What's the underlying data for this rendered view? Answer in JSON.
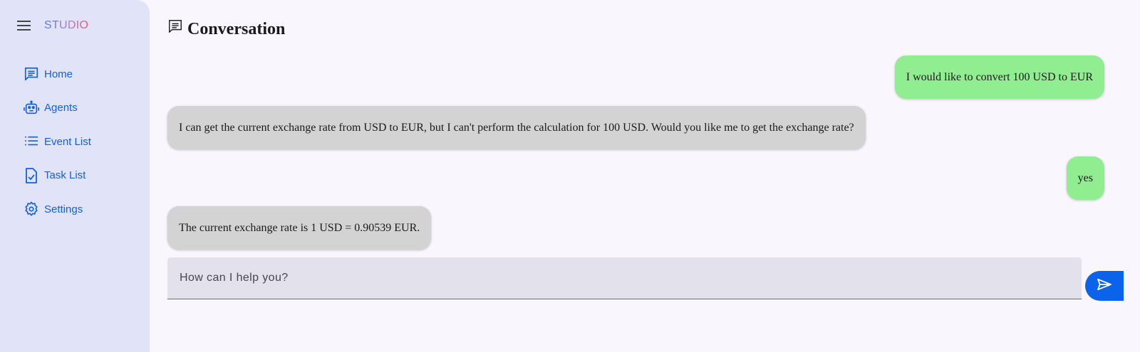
{
  "sidebar": {
    "brand": "STUDIO",
    "items": [
      {
        "label": "Home",
        "icon": "chat-icon"
      },
      {
        "label": "Agents",
        "icon": "robot-icon"
      },
      {
        "label": "Event List",
        "icon": "list-icon"
      },
      {
        "label": "Task List",
        "icon": "task-icon"
      },
      {
        "label": "Settings",
        "icon": "gear-icon"
      }
    ]
  },
  "header": {
    "title": "Conversation",
    "icon": "chat-icon"
  },
  "messages": [
    {
      "role": "user",
      "text": "I would like to convert 100 USD to EUR"
    },
    {
      "role": "agent",
      "text": "I can get the current exchange rate from USD to EUR, but I can't perform the calculation for 100 USD. Would you like me to get the exchange rate?"
    },
    {
      "role": "user",
      "text": "yes"
    },
    {
      "role": "agent",
      "text": "The current exchange rate is 1 USD = 0.90539 EUR."
    }
  ],
  "input": {
    "placeholder": "How can I help you?",
    "value": ""
  },
  "send": {
    "icon": "send-icon"
  },
  "colors": {
    "accent": "#1560d8",
    "send_button": "#0a63e8",
    "user_bubble": "#90ee90",
    "agent_bubble": "#d3d3d3",
    "sidebar_bg": "#e1e3f8"
  }
}
